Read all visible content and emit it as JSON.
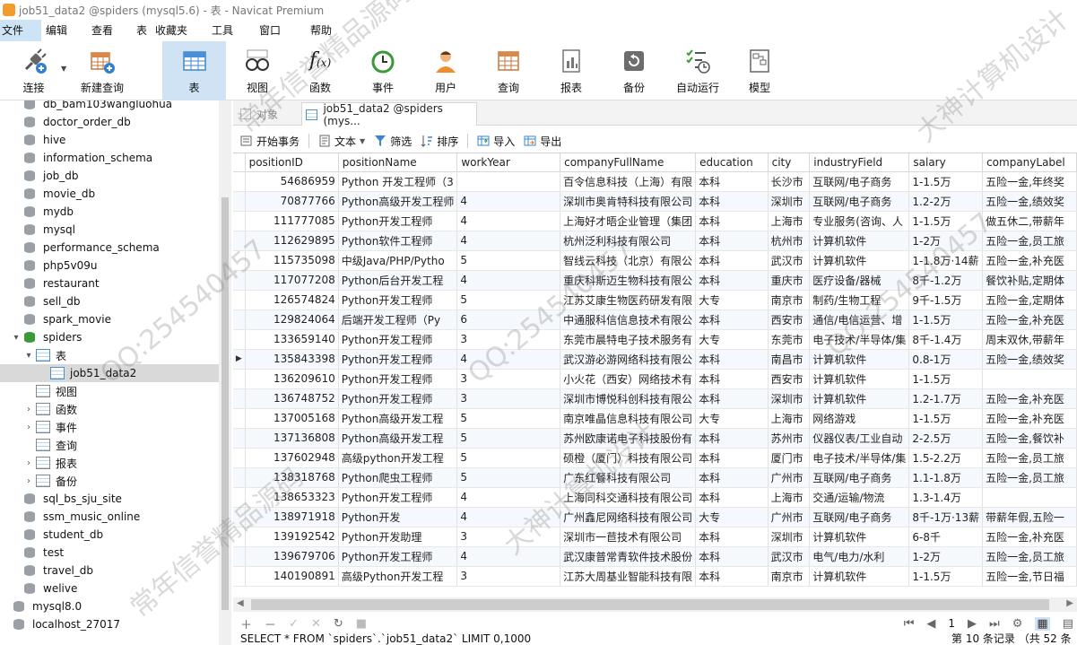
{
  "window": {
    "title": "job51_data2 @spiders (mysql5.6) - 表 - Navicat Premium"
  },
  "menu": [
    "文件",
    "编辑",
    "查看",
    "表",
    "收藏夹",
    "工具",
    "窗口",
    "帮助"
  ],
  "toolbar": [
    "连接",
    "新建查询",
    "表",
    "视图",
    "函数",
    "事件",
    "用户",
    "查询",
    "报表",
    "备份",
    "自动运行",
    "模型"
  ],
  "sidebar": {
    "items": [
      {
        "label": "db_bam103wangluohua",
        "type": "db"
      },
      {
        "label": "doctor_order_db",
        "type": "db"
      },
      {
        "label": "hive",
        "type": "db"
      },
      {
        "label": "information_schema",
        "type": "db"
      },
      {
        "label": "job_db",
        "type": "db"
      },
      {
        "label": "movie_db",
        "type": "db"
      },
      {
        "label": "mydb",
        "type": "db"
      },
      {
        "label": "mysql",
        "type": "db"
      },
      {
        "label": "performance_schema",
        "type": "db"
      },
      {
        "label": "php5v09u",
        "type": "db"
      },
      {
        "label": "restaurant",
        "type": "db"
      },
      {
        "label": "sell_db",
        "type": "db"
      },
      {
        "label": "spark_movie",
        "type": "db"
      },
      {
        "label": "spiders",
        "type": "db-open"
      },
      {
        "label": "表",
        "type": "folder-open"
      },
      {
        "label": "job51_data2",
        "type": "table"
      },
      {
        "label": "视图",
        "type": "sub"
      },
      {
        "label": "函数",
        "type": "sub-chev"
      },
      {
        "label": "事件",
        "type": "sub-chev"
      },
      {
        "label": "查询",
        "type": "sub"
      },
      {
        "label": "报表",
        "type": "sub-chev"
      },
      {
        "label": "备份",
        "type": "sub-chev"
      },
      {
        "label": "sql_bs_sju_site",
        "type": "db"
      },
      {
        "label": "ssm_music_online",
        "type": "db"
      },
      {
        "label": "student_db",
        "type": "db"
      },
      {
        "label": "test",
        "type": "db"
      },
      {
        "label": "travel_db",
        "type": "db"
      },
      {
        "label": "welive",
        "type": "db"
      },
      {
        "label": "mysql8.0",
        "type": "conn"
      },
      {
        "label": "localhost_27017",
        "type": "conn"
      }
    ]
  },
  "tabs": {
    "objects": "对象",
    "active": "job51_data2 @spiders (mys..."
  },
  "actions": [
    "开始事务",
    "文本",
    "筛选",
    "排序",
    "导入",
    "导出"
  ],
  "columns": [
    "positionID",
    "positionName",
    "workYear",
    "companyFullName",
    "education",
    "city",
    "industryField",
    "salary",
    "companyLabel"
  ],
  "rows": [
    [
      "54686959",
      "Python 开发工程师（3",
      "",
      "百令信息科技（上海）有限",
      "本科",
      "长沙市",
      "互联网/电子商务",
      "1-1.5万",
      "五险一金,年终奖"
    ],
    [
      "70877766",
      "Python高级开发工程师",
      "4",
      "深圳市奥肯特科技有限公司",
      "本科",
      "深圳市",
      "互联网/电子商务",
      "1.2-2万",
      "五险一金,绩效奖"
    ],
    [
      "111777085",
      "Python开发工程师",
      "4",
      "上海好才晤企业管理（集团",
      "本科",
      "上海市",
      "专业服务(咨询、人",
      "1-1.5万",
      "做五休二,带薪年"
    ],
    [
      "112629895",
      "Python软件工程师",
      "4",
      "杭州泛利科技有限公司",
      "本科",
      "杭州市",
      "计算机软件",
      "1-2万",
      "五险一金,员工旅"
    ],
    [
      "115735098",
      "中级Java/PHP/Pytho",
      "5",
      "智线云科技（北京）有限公",
      "本科",
      "武汉市",
      "计算机软件",
      "1-1.8万·14薪",
      "五险一金,补充医"
    ],
    [
      "117077208",
      "Python后台开发工程",
      "4",
      "重庆科斯迈生物科技有限公",
      "本科",
      "重庆市",
      "医疗设备/器械",
      "8千-1.2万",
      "餐饮补贴,定期体"
    ],
    [
      "126574824",
      "Python开发工程师",
      "5",
      "江苏艾康生物医药研发有限",
      "大专",
      "南京市",
      "制药/生物工程",
      "9千-1.5万",
      "五险一金,定期体"
    ],
    [
      "129824064",
      "后端开发工程师（Py",
      "6",
      "中通服科信信息技术有限公",
      "本科",
      "西安市",
      "通信/电信运营、增",
      "1-1.5万",
      "五险一金,补充医"
    ],
    [
      "133659140",
      "Python开发工程师",
      "3",
      "东莞市晨特电子技术服务有",
      "大专",
      "东莞市",
      "电子技术/半导体/集",
      "8千-1.4万",
      "周末双休,带薪年"
    ],
    [
      "135843398",
      "Python开发工程师",
      "4",
      "武汉游必游网络科技有限公",
      "本科",
      "南昌市",
      "计算机软件",
      "0.8-1万",
      "五险一金,绩效奖"
    ],
    [
      "136209610",
      "Python开发工程师",
      "3",
      "小火花（西安）网络技术有",
      "本科",
      "西安市",
      "计算机软件",
      "1-1.5万",
      ""
    ],
    [
      "136748752",
      "Python开发工程师",
      "3",
      "深圳市博悦科创科技有限公",
      "本科",
      "深圳市",
      "计算机软件",
      "1.2-1.7万",
      "五险一金,补充医"
    ],
    [
      "137005168",
      "Python高级开发工程",
      "5",
      "南京唯晶信息科技有限公司",
      "大专",
      "上海市",
      "网络游戏",
      "1-1.5万",
      "五险一金,补充医"
    ],
    [
      "137136808",
      "Python高级开发工程",
      "5",
      "苏州欧康诺电子科技股份有",
      "本科",
      "苏州市",
      "仪器仪表/工业自动",
      "2-2.5万",
      "五险一金,餐饮补"
    ],
    [
      "137602948",
      "高级python开发工程",
      "5",
      "硕橙（厦门）科技有限公司",
      "本科",
      "厦门市",
      "电子技术/半导体/集",
      "1.5-2.2万",
      "五险一金,员工旅"
    ],
    [
      "138318768",
      "Python爬虫工程师",
      "5",
      "广东红餐科技有限公司",
      "本科",
      "广州市",
      "互联网/电子商务",
      "1.1-1.8万",
      "五险一金,员工旅"
    ],
    [
      "138653323",
      "Python开发工程师",
      "4",
      "上海同科交通科技有限公司",
      "本科",
      "上海市",
      "交通/运输/物流",
      "1.3-1.4万",
      ""
    ],
    [
      "138971918",
      "Python开发",
      "4",
      "广州鑫尼网络科技有限公司",
      "大专",
      "广州市",
      "互联网/电子商务",
      "8千-1万·13薪",
      "带薪年假,五险一"
    ],
    [
      "139192542",
      "Python开发助理",
      "3",
      "深圳市一苣技术有限公司",
      "本科",
      "深圳市",
      "计算机软件",
      "6-8千",
      "五险一金,补充医"
    ],
    [
      "139679706",
      "Python开发工程师",
      "4",
      "武汉康普常青软件技术股份",
      "本科",
      "武汉市",
      "电气/电力/水利",
      "1-2万",
      "五险一金,员工旅"
    ],
    [
      "140190891",
      "高级Python开发工程",
      "3",
      "江苏大周基业智能科技有限",
      "本科",
      "南京市",
      "计算机软件",
      "1-1.5万",
      "五险一金,节日福"
    ]
  ],
  "bottom": {
    "page": "1"
  },
  "status": {
    "sql": "SELECT * FROM `spiders`.`job51_data2` LIMIT 0,1000",
    "records": "第 10 条记录 （共 52 条"
  },
  "watermarks": [
    "常年信誉精品源码",
    "QQ:254540457",
    "大神计算机设计",
    "QQ:254540457"
  ]
}
